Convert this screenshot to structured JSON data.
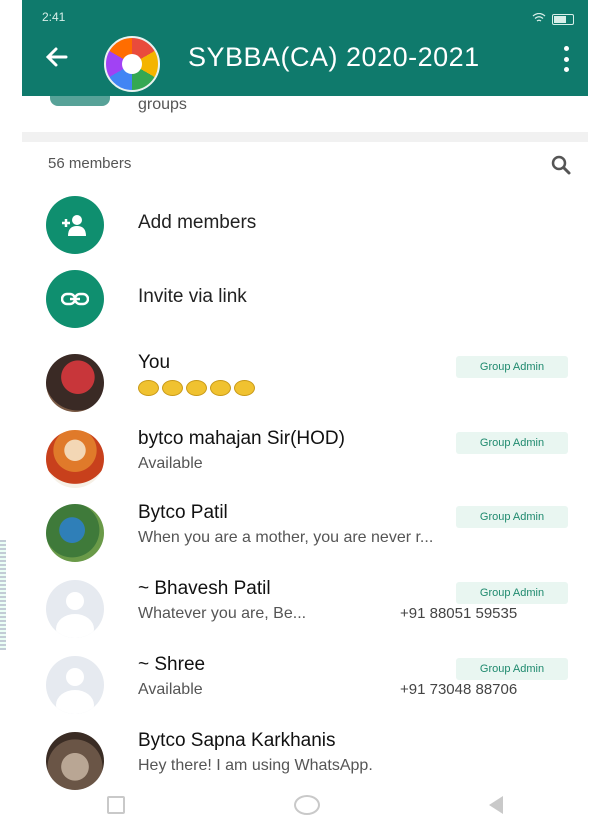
{
  "status_bar": {
    "time": "2:41"
  },
  "header": {
    "title": "SYBBA(CA) 2020-2021"
  },
  "prev_section": {
    "text": "groups"
  },
  "members": {
    "count_label": "56 members"
  },
  "actions": [
    {
      "label": "Add members",
      "icon": "add-person-icon"
    },
    {
      "label": "Invite via link",
      "icon": "link-icon"
    }
  ],
  "participants": [
    {
      "name": "You",
      "about": "",
      "badge": "Group Admin",
      "phone": "",
      "avatar": "photo"
    },
    {
      "name": "bytco mahajan Sir(HOD)",
      "about": "Available",
      "badge": "Group Admin",
      "phone": "",
      "avatar": "photo"
    },
    {
      "name": "Bytco Patil",
      "about": "When you are a mother, you are never r...",
      "badge": "Group Admin",
      "phone": "",
      "avatar": "photo"
    },
    {
      "name": "~ Bhavesh Patil",
      "about": "Whatever you are, Be...",
      "badge": "Group Admin",
      "phone": "+91 88051 59535",
      "avatar": "placeholder"
    },
    {
      "name": "~ Shree",
      "about": "Available",
      "badge": "Group Admin",
      "phone": "+91 73048 88706",
      "avatar": "placeholder"
    },
    {
      "name": "Bytco Sapna Karkhanis",
      "about": "Hey there! I am using WhatsApp.",
      "badge": "",
      "phone": "",
      "avatar": "photo"
    }
  ],
  "colors": {
    "header": "#0f7a6c",
    "accent": "#0f8f6f",
    "badge_text": "#1f8a6e"
  }
}
